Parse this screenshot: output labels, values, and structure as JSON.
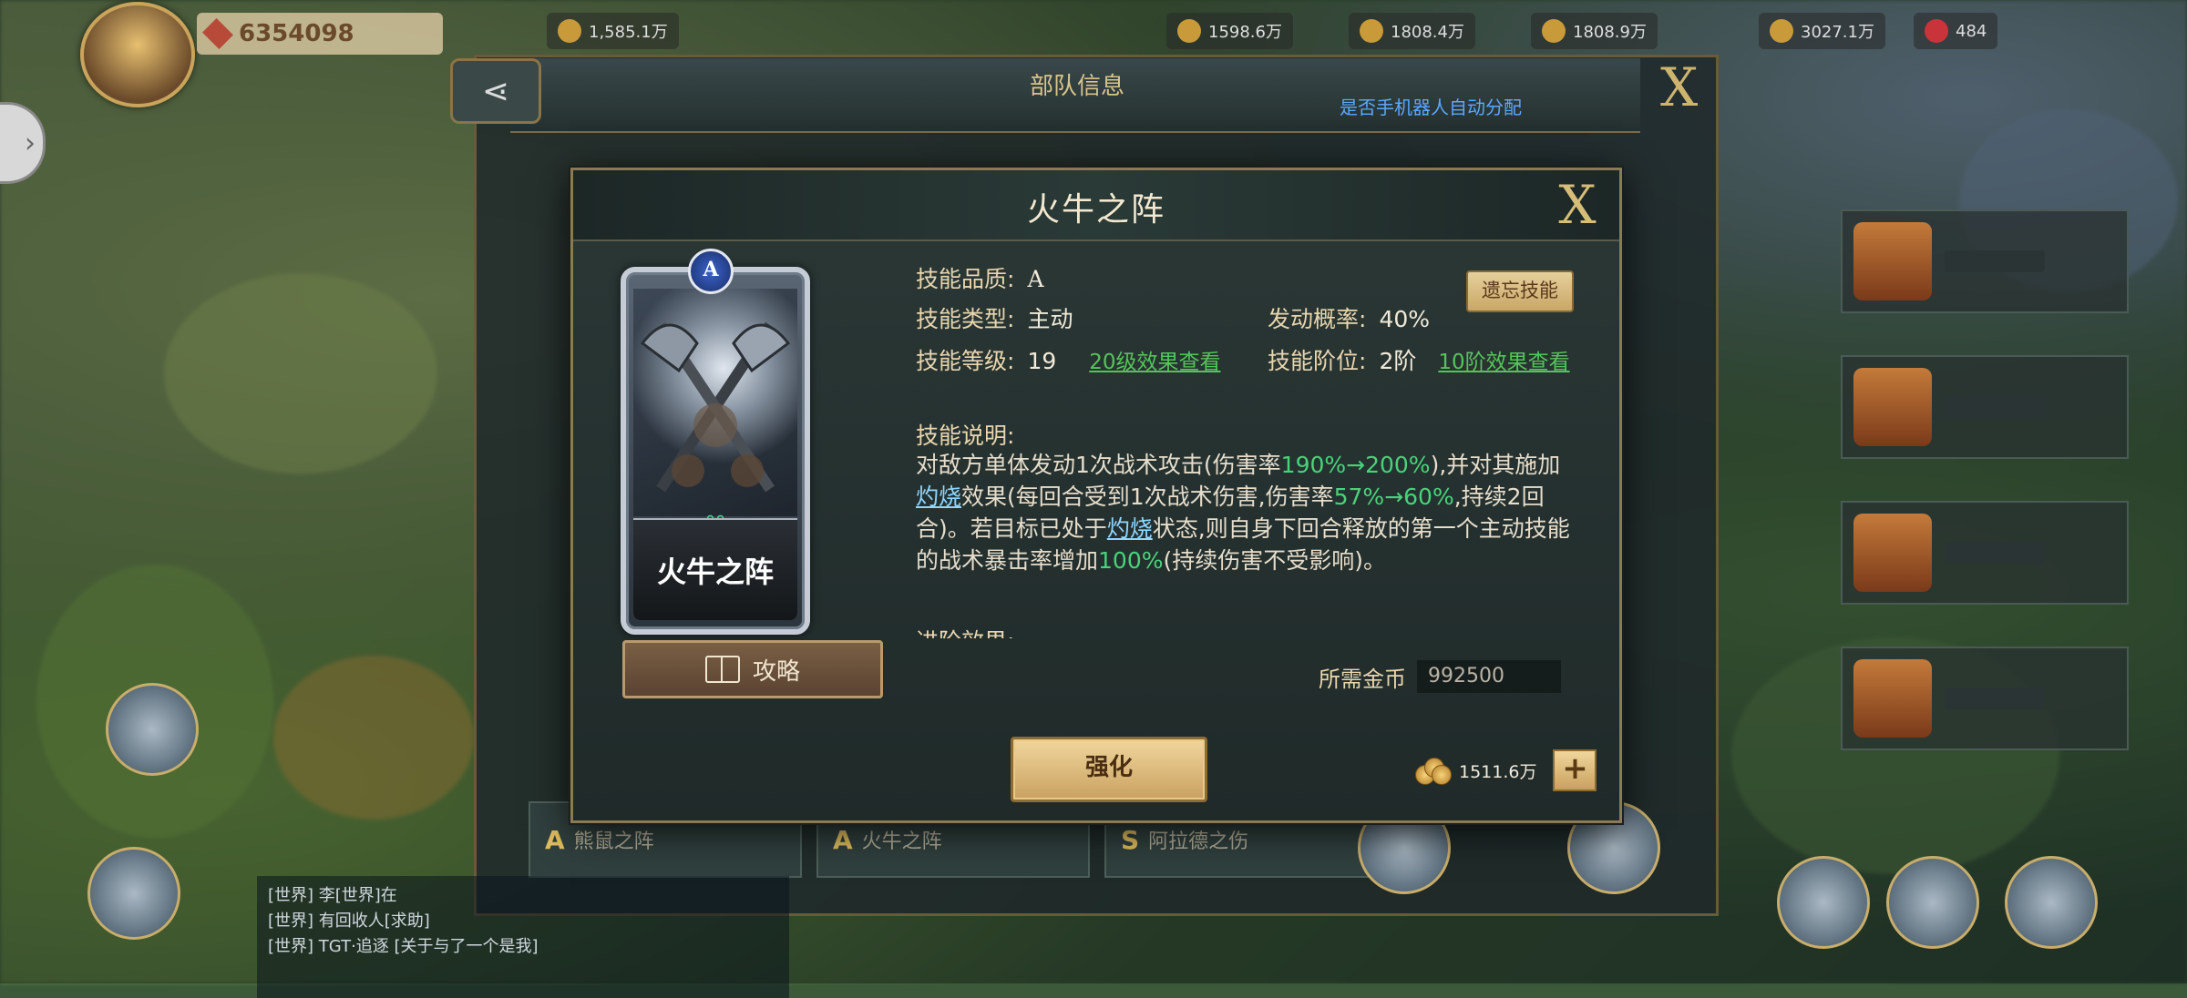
{
  "hud": {
    "player_power": "6354098",
    "resources": [
      "1,585.1万",
      "1598.6万",
      "1808.4万",
      "1808.9万",
      "3027.1万",
      "484"
    ]
  },
  "team_panel": {
    "title": "部队信息",
    "subtitle": "是否手机器人自动分配",
    "slots": [
      {
        "grade": "A",
        "name": "熊鼠之阵"
      },
      {
        "grade": "A",
        "name": "火牛之阵"
      },
      {
        "grade": "S",
        "name": "阿拉德之伤"
      }
    ]
  },
  "chat": {
    "lines": [
      "[世界] 李[世界]在",
      "[世界] 有回收人[求助]",
      "[世界] TGT·追逐 [关于与了一个是我]"
    ]
  },
  "modal": {
    "title": "火牛之阵",
    "card_name": "火牛之阵",
    "card_grade_emblem": "A",
    "guide_label": "攻略",
    "forget_label": "遗忘技能",
    "quality_label": "技能品质:",
    "quality_value": "A",
    "type_label": "技能类型:",
    "type_value": "主动",
    "chance_label": "发动概率:",
    "chance_value": "40%",
    "level_label": "技能等级:",
    "level_value": "19",
    "level_link": "20级效果查看",
    "rank_label": "技能阶位:",
    "rank_value": "2阶",
    "rank_link": "10阶效果查看",
    "desc_title": "技能说明:",
    "desc": {
      "p1": "对敌方单体发动1次战术攻击(伤害率",
      "n1": "190%→200%",
      "p2": "),并对其施加",
      "k1": "灼烧",
      "p3": "效果(每回合受到1次战术伤害,伤害率",
      "n2": "57%→60%",
      "p4": ",持续2回合)。若目标已处于",
      "k2": "灼烧",
      "p5": "状态,则自身下回合释放的第一个主动技能的战术暴击率增加",
      "n3": "100%",
      "p6": "(持续伤害不受影响)。"
    },
    "advance_title": "进阶效果:",
    "cost_label": "所需金币",
    "cost_value": "992500",
    "strengthen_label": "强化",
    "gold_amount": "1511.6万"
  },
  "colors": {
    "accent_gold": "#d6bd78",
    "number_green": "#48d37a",
    "keyword_blue": "#8fd6ff",
    "link_green": "#55c45a"
  }
}
